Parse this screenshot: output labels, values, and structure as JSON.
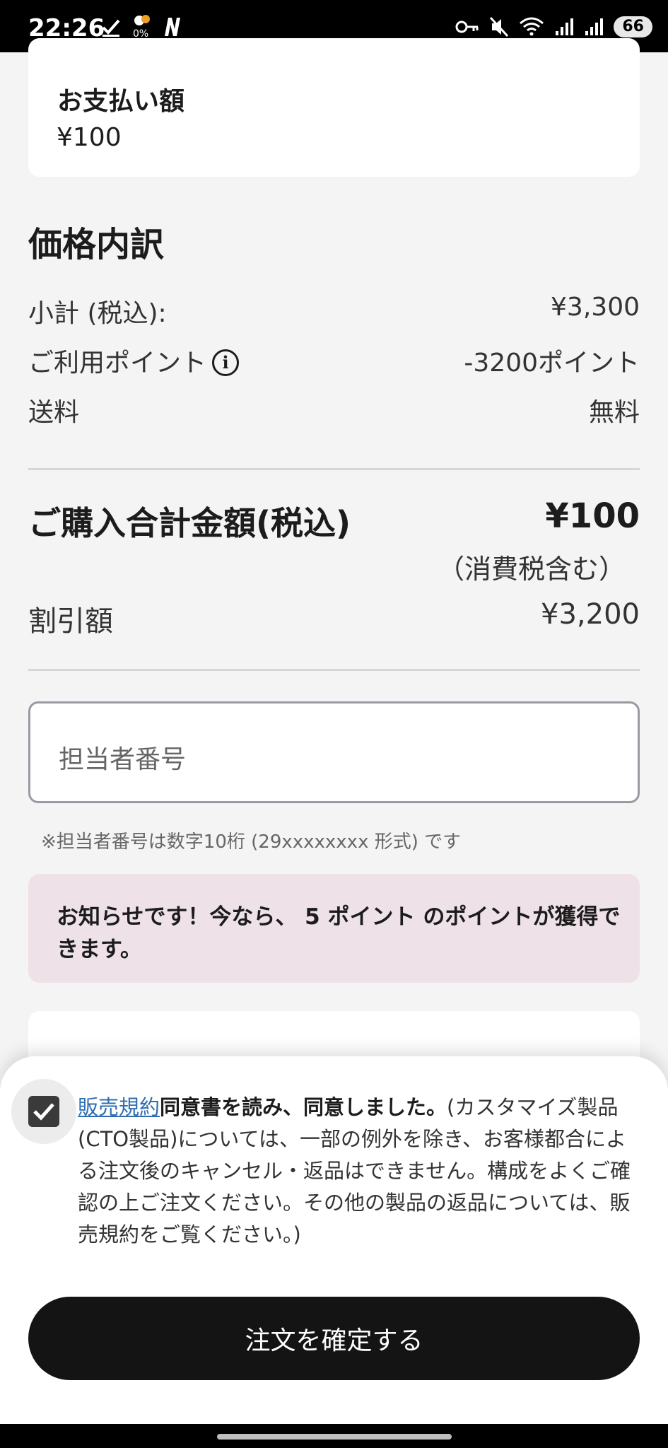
{
  "status": {
    "time": "22:26",
    "battery": "66",
    "data_percent": "0%"
  },
  "payment": {
    "label": "お支払い額",
    "amount": "¥100"
  },
  "breakdown": {
    "title": "価格内訳",
    "subtotal_label": "小計 (税込):",
    "subtotal_value": "¥3,300",
    "points_label": "ご利用ポイント",
    "points_value": "-3200ポイント",
    "shipping_label": "送料",
    "shipping_value": "無料"
  },
  "total": {
    "label": "ご購入合計金額(税込)",
    "value": "¥100",
    "tax_note": "（消費税含む）",
    "discount_label": "割引額",
    "discount_value": "¥3,200"
  },
  "staff": {
    "placeholder": "担当者番号",
    "hint": "※担当者番号は数字10桁 (29xxxxxxxx 形式) です"
  },
  "notice": {
    "text": "お知らせです！今なら、 5 ポイント のポイントが獲得できます。"
  },
  "agreement": {
    "link": "販売規約",
    "bold": "同意書を読み、同意しました。",
    "text": "(カスタマイズ製品 (CTO製品)については、一部の例外を除き、お客様都合による注文後のキャンセル・返品はできません。構成をよくご確認の上ご注文ください。その他の製品の返品については、販売規約をご覧ください。)",
    "checked": true
  },
  "confirm_button": "注文を確定する"
}
